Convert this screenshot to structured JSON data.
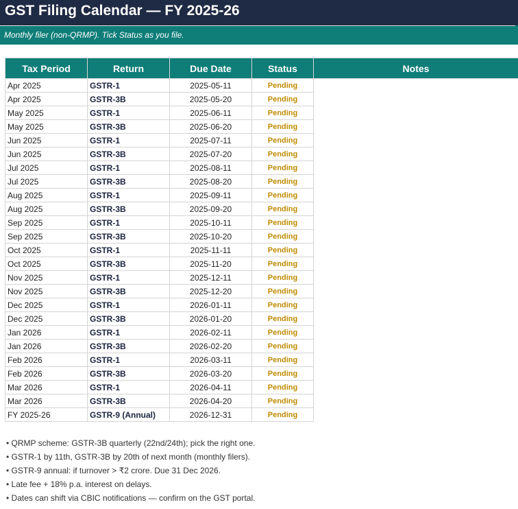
{
  "header": {
    "title": "GST Filing Calendar — FY 2025-26",
    "subtitle": "Monthly filer (non-QRMP). Tick Status as you file."
  },
  "table": {
    "columns": [
      "Tax Period",
      "Return",
      "Due Date",
      "Status",
      "Notes"
    ],
    "rows": [
      {
        "period": "Apr 2025",
        "return": "GSTR-1",
        "due": "2025-05-11",
        "status": "Pending"
      },
      {
        "period": "Apr 2025",
        "return": "GSTR-3B",
        "due": "2025-05-20",
        "status": "Pending"
      },
      {
        "period": "May 2025",
        "return": "GSTR-1",
        "due": "2025-06-11",
        "status": "Pending"
      },
      {
        "period": "May 2025",
        "return": "GSTR-3B",
        "due": "2025-06-20",
        "status": "Pending"
      },
      {
        "period": "Jun 2025",
        "return": "GSTR-1",
        "due": "2025-07-11",
        "status": "Pending"
      },
      {
        "period": "Jun 2025",
        "return": "GSTR-3B",
        "due": "2025-07-20",
        "status": "Pending"
      },
      {
        "period": "Jul 2025",
        "return": "GSTR-1",
        "due": "2025-08-11",
        "status": "Pending"
      },
      {
        "period": "Jul 2025",
        "return": "GSTR-3B",
        "due": "2025-08-20",
        "status": "Pending"
      },
      {
        "period": "Aug 2025",
        "return": "GSTR-1",
        "due": "2025-09-11",
        "status": "Pending"
      },
      {
        "period": "Aug 2025",
        "return": "GSTR-3B",
        "due": "2025-09-20",
        "status": "Pending"
      },
      {
        "period": "Sep 2025",
        "return": "GSTR-1",
        "due": "2025-10-11",
        "status": "Pending"
      },
      {
        "period": "Sep 2025",
        "return": "GSTR-3B",
        "due": "2025-10-20",
        "status": "Pending"
      },
      {
        "period": "Oct 2025",
        "return": "GSTR-1",
        "due": "2025-11-11",
        "status": "Pending"
      },
      {
        "period": "Oct 2025",
        "return": "GSTR-3B",
        "due": "2025-11-20",
        "status": "Pending"
      },
      {
        "period": "Nov 2025",
        "return": "GSTR-1",
        "due": "2025-12-11",
        "status": "Pending"
      },
      {
        "period": "Nov 2025",
        "return": "GSTR-3B",
        "due": "2025-12-20",
        "status": "Pending"
      },
      {
        "period": "Dec 2025",
        "return": "GSTR-1",
        "due": "2026-01-11",
        "status": "Pending"
      },
      {
        "period": "Dec 2025",
        "return": "GSTR-3B",
        "due": "2026-01-20",
        "status": "Pending"
      },
      {
        "period": "Jan 2026",
        "return": "GSTR-1",
        "due": "2026-02-11",
        "status": "Pending"
      },
      {
        "period": "Jan 2026",
        "return": "GSTR-3B",
        "due": "2026-02-20",
        "status": "Pending"
      },
      {
        "period": "Feb 2026",
        "return": "GSTR-1",
        "due": "2026-03-11",
        "status": "Pending"
      },
      {
        "period": "Feb 2026",
        "return": "GSTR-3B",
        "due": "2026-03-20",
        "status": "Pending"
      },
      {
        "period": "Mar 2026",
        "return": "GSTR-1",
        "due": "2026-04-11",
        "status": "Pending"
      },
      {
        "period": "Mar 2026",
        "return": "GSTR-3B",
        "due": "2026-04-20",
        "status": "Pending"
      },
      {
        "period": "FY 2025-26",
        "return": "GSTR-9 (Annual)",
        "due": "2026-12-31",
        "status": "Pending"
      }
    ]
  },
  "notes": [
    "• QRMP scheme: GSTR-3B quarterly (22nd/24th); pick the right one.",
    "• GSTR-1 by 11th, GSTR-3B by 20th of next month (monthly filers).",
    "• GSTR-9 annual: if turnover > ₹2 crore. Due 31 Dec 2026.",
    "• Late fee + 18% p.a. interest on delays.",
    "• Dates can shift via CBIC notifications — confirm on the GST portal."
  ],
  "colors": {
    "title_bar": "#1f2a44",
    "accent_teal": "#0f7d78",
    "status_pending": "#bf8a00"
  }
}
